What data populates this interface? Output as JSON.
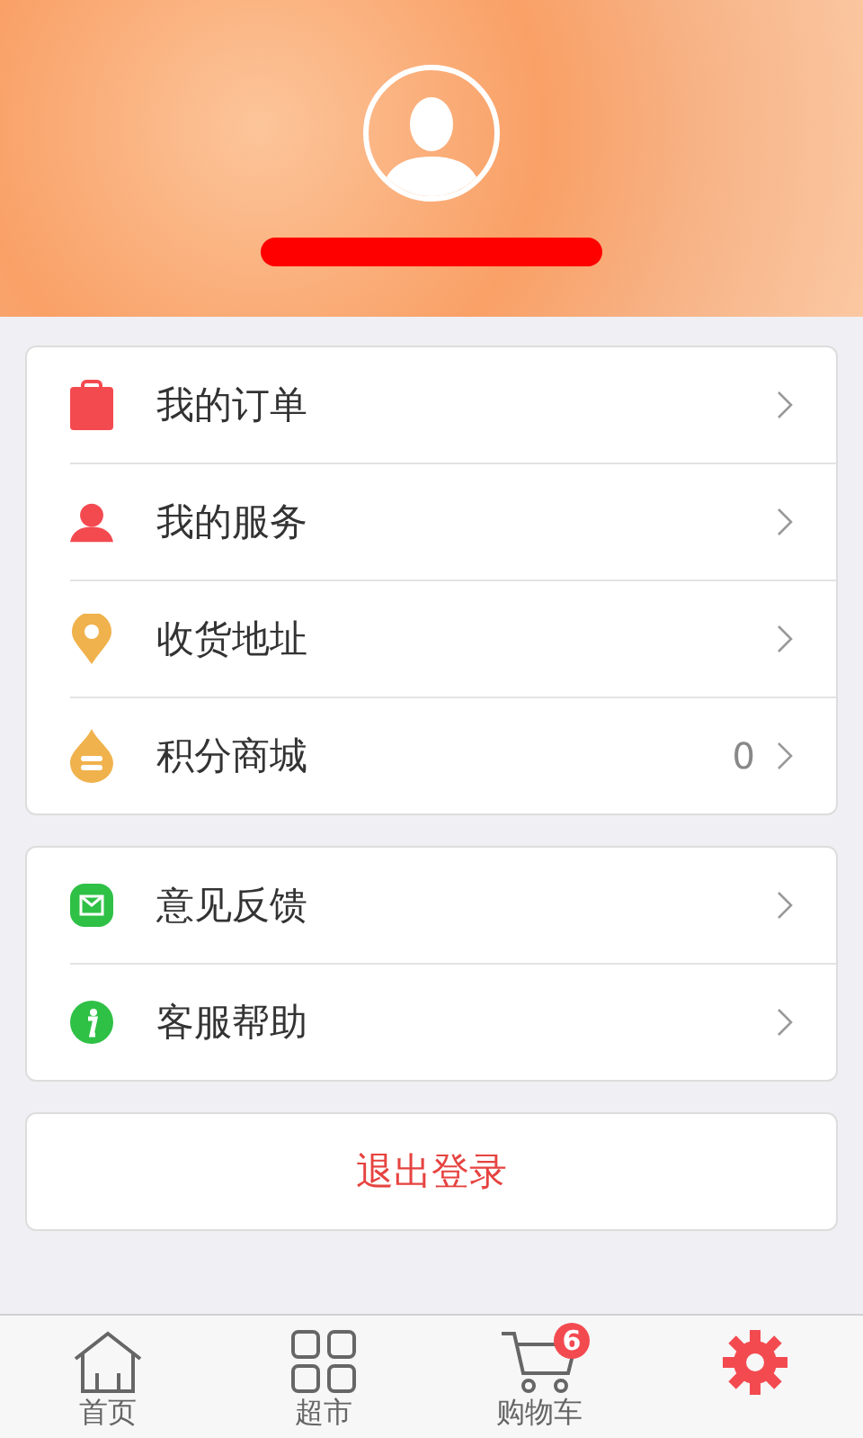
{
  "menu_groups": [
    {
      "items": [
        {
          "kind": "clipboard",
          "label": "我的订单"
        },
        {
          "kind": "person",
          "label": "我的服务"
        },
        {
          "kind": "pin",
          "label": "收货地址"
        },
        {
          "kind": "coins",
          "label": "积分商城",
          "count": "0"
        }
      ]
    },
    {
      "items": [
        {
          "kind": "mail",
          "label": "意见反馈"
        },
        {
          "kind": "info",
          "label": "客服帮助"
        }
      ]
    }
  ],
  "logout_button": "退出登录",
  "tab_bar": [
    {
      "kind": "home",
      "label": "首页",
      "selected": false
    },
    {
      "kind": "grid",
      "label": "超市",
      "selected": false
    },
    {
      "kind": "cart",
      "label": "购物车",
      "badge": "6",
      "selected": false
    },
    {
      "kind": "gear",
      "selected": true
    }
  ]
}
